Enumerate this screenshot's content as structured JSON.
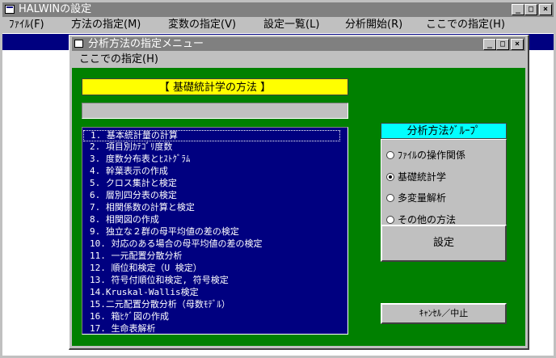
{
  "app": {
    "title": "HALWINの設定",
    "window_buttons": [
      "_",
      "□",
      "×"
    ]
  },
  "menubar": {
    "items": [
      "ﾌｧｲﾙ(F)",
      "方法の指定(M)",
      "変数の指定(V)",
      "設定一覧(L)",
      "分析開始(R)",
      "ここでの指定(H)"
    ]
  },
  "dialog": {
    "title": "分析方法の指定メニュー",
    "menu": "ここでの指定(H)",
    "window_buttons": [
      "_",
      "□",
      "×"
    ],
    "header": "【 基礎統計学の方法 】",
    "gray_bar_text": "",
    "list": [
      "1. 基本統計量の計算",
      "2. 項目別ｶﾃｺﾞﾘ度数",
      "3. 度数分布表とﾋｽﾄｸﾞﾗﾑ",
      "4. 幹葉表示の作成",
      "5. クロス集計と検定",
      "6. 層別四分表の検定",
      "7. 相関係数の計算と検定",
      "8. 相関図の作成",
      "9. 独立な２群の母平均値の差の検定",
      "10. 対応のある場合の母平均値の差の検定",
      "11. 一元配置分散分析",
      "12. 順位和検定（U 検定）",
      "13. 符号付順位和検定, 符号検定",
      "14.Kruskal-Wallis検定",
      "15.二元配置分散分析（母数ﾓﾃﾞﾙ）",
      "16. 箱ﾋｹﾞ図の作成",
      "17. 生命表解析"
    ],
    "selected_index": 0,
    "group": {
      "title": "分析方法ｸﾞﾙｰﾌﾟ",
      "options": [
        "ﾌｧｲﾙの操作関係",
        "基礎統計学",
        "多変量解析",
        "その他の方法"
      ],
      "selected_index": 1
    },
    "buttons": {
      "set": "設定",
      "cancel": "ｷｬﾝｾﾙ／中止"
    }
  },
  "colors": {
    "dialog_background": "#008000",
    "list_background": "#000080",
    "header_background": "#ffff00",
    "group_title_background": "#00ffff"
  }
}
